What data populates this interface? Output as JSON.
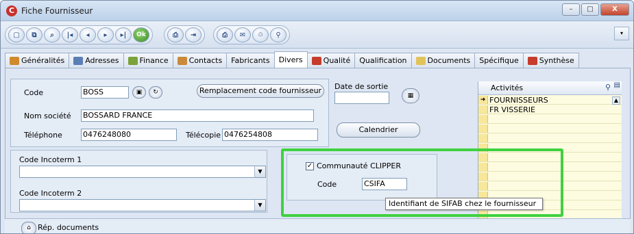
{
  "window": {
    "title": "Fiche Fournisseur",
    "logo": "C",
    "minimize": "–",
    "maximize": "□",
    "close": "X"
  },
  "toolbar": {
    "buttons": [
      "new-icon",
      "copy-icon",
      "search-icon",
      "first-icon",
      "prev-icon",
      "next-icon",
      "last-icon",
      "ok-icon",
      "print-preview-icon",
      "exit-icon",
      "printer-icon",
      "fax-icon",
      "trash-icon",
      "zoom-icon"
    ],
    "ok_label": "Ok",
    "dropdown": "▾"
  },
  "tabs": [
    {
      "label": "Généralités",
      "icon_color": "#d08a2c"
    },
    {
      "label": "Adresses",
      "icon_color": "#5a7fb5"
    },
    {
      "label": "Finance",
      "icon_color": "#7aa33a"
    },
    {
      "label": "Contacts",
      "icon_color": "#c98b3b"
    },
    {
      "label": "Fabricants",
      "icon_color": ""
    },
    {
      "label": "Divers",
      "icon_color": ""
    },
    {
      "label": "Qualité",
      "icon_color": "#c73b2b"
    },
    {
      "label": "Qualification",
      "icon_color": ""
    },
    {
      "label": "Documents",
      "icon_color": "#e1c35a"
    },
    {
      "label": "Spécifique",
      "icon_color": ""
    },
    {
      "label": "Synthèse",
      "icon_color": "#c73b2b"
    }
  ],
  "active_tab": "Divers",
  "form": {
    "code_label": "Code",
    "code_value": "BOSS",
    "replace_button": "Remplacement code fournisseur",
    "company_label": "Nom société",
    "company_value": "BOSSARD FRANCE",
    "phone_label": "Téléphone",
    "phone_value": "0476248080",
    "fax_label": "Télécopie",
    "fax_value": "0476254808",
    "exit_date_label": "Date de sortie",
    "exit_date_value": "",
    "calendar_button": "Calendrier",
    "incoterm1_label": "Code Incoterm 1",
    "incoterm1_value": "",
    "incoterm2_label": "Code Incoterm 2",
    "incoterm2_value": "",
    "clipper_checkbox_label": "Communauté CLIPPER",
    "clipper_checked": true,
    "clipper_code_label": "Code",
    "clipper_code_value": "CSIFA",
    "tooltip": "Identifiant de SIFAB chez le fournisseur",
    "docs_label": "Rép. documents"
  },
  "activities": {
    "header": "Activités",
    "items": [
      "FOURNISSEURS",
      "FR VISSERIE"
    ],
    "selected_marker": "➜"
  },
  "colors": {
    "highlight": "#3fd13f",
    "list_bg": "#fdfbe0"
  }
}
